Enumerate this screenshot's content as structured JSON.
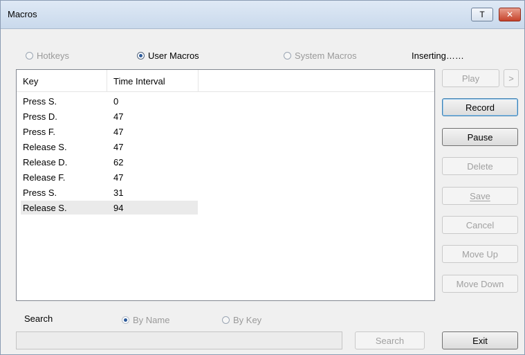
{
  "window": {
    "title": "Macros",
    "pin_glyph": "T",
    "close_glyph": "✕"
  },
  "mode": {
    "hotkeys": "Hotkeys",
    "user_macros": "User Macros",
    "system_macros": "System Macros",
    "selected": "User Macros",
    "status": "Inserting……"
  },
  "table": {
    "columns": [
      "Key",
      "Time Interval"
    ],
    "rows": [
      {
        "key": "Press S.",
        "interval": "0"
      },
      {
        "key": "Press D.",
        "interval": "47"
      },
      {
        "key": "Press F.",
        "interval": "47"
      },
      {
        "key": "Release S.",
        "interval": "47"
      },
      {
        "key": "Release D.",
        "interval": "62"
      },
      {
        "key": "Release F.",
        "interval": "47"
      },
      {
        "key": "Press S.",
        "interval": "31"
      },
      {
        "key": "Release S.",
        "interval": "94"
      }
    ]
  },
  "buttons": {
    "play": "Play",
    "more": ">",
    "record": "Record",
    "pause": "Pause",
    "delete": "Delete",
    "save": "Save",
    "cancel": "Cancel",
    "move_up": "Move Up",
    "move_down": "Move Down",
    "search": "Search",
    "exit": "Exit"
  },
  "search": {
    "label": "Search",
    "by_name": "By Name",
    "by_key": "By Key",
    "selected": "By Name",
    "value": ""
  }
}
